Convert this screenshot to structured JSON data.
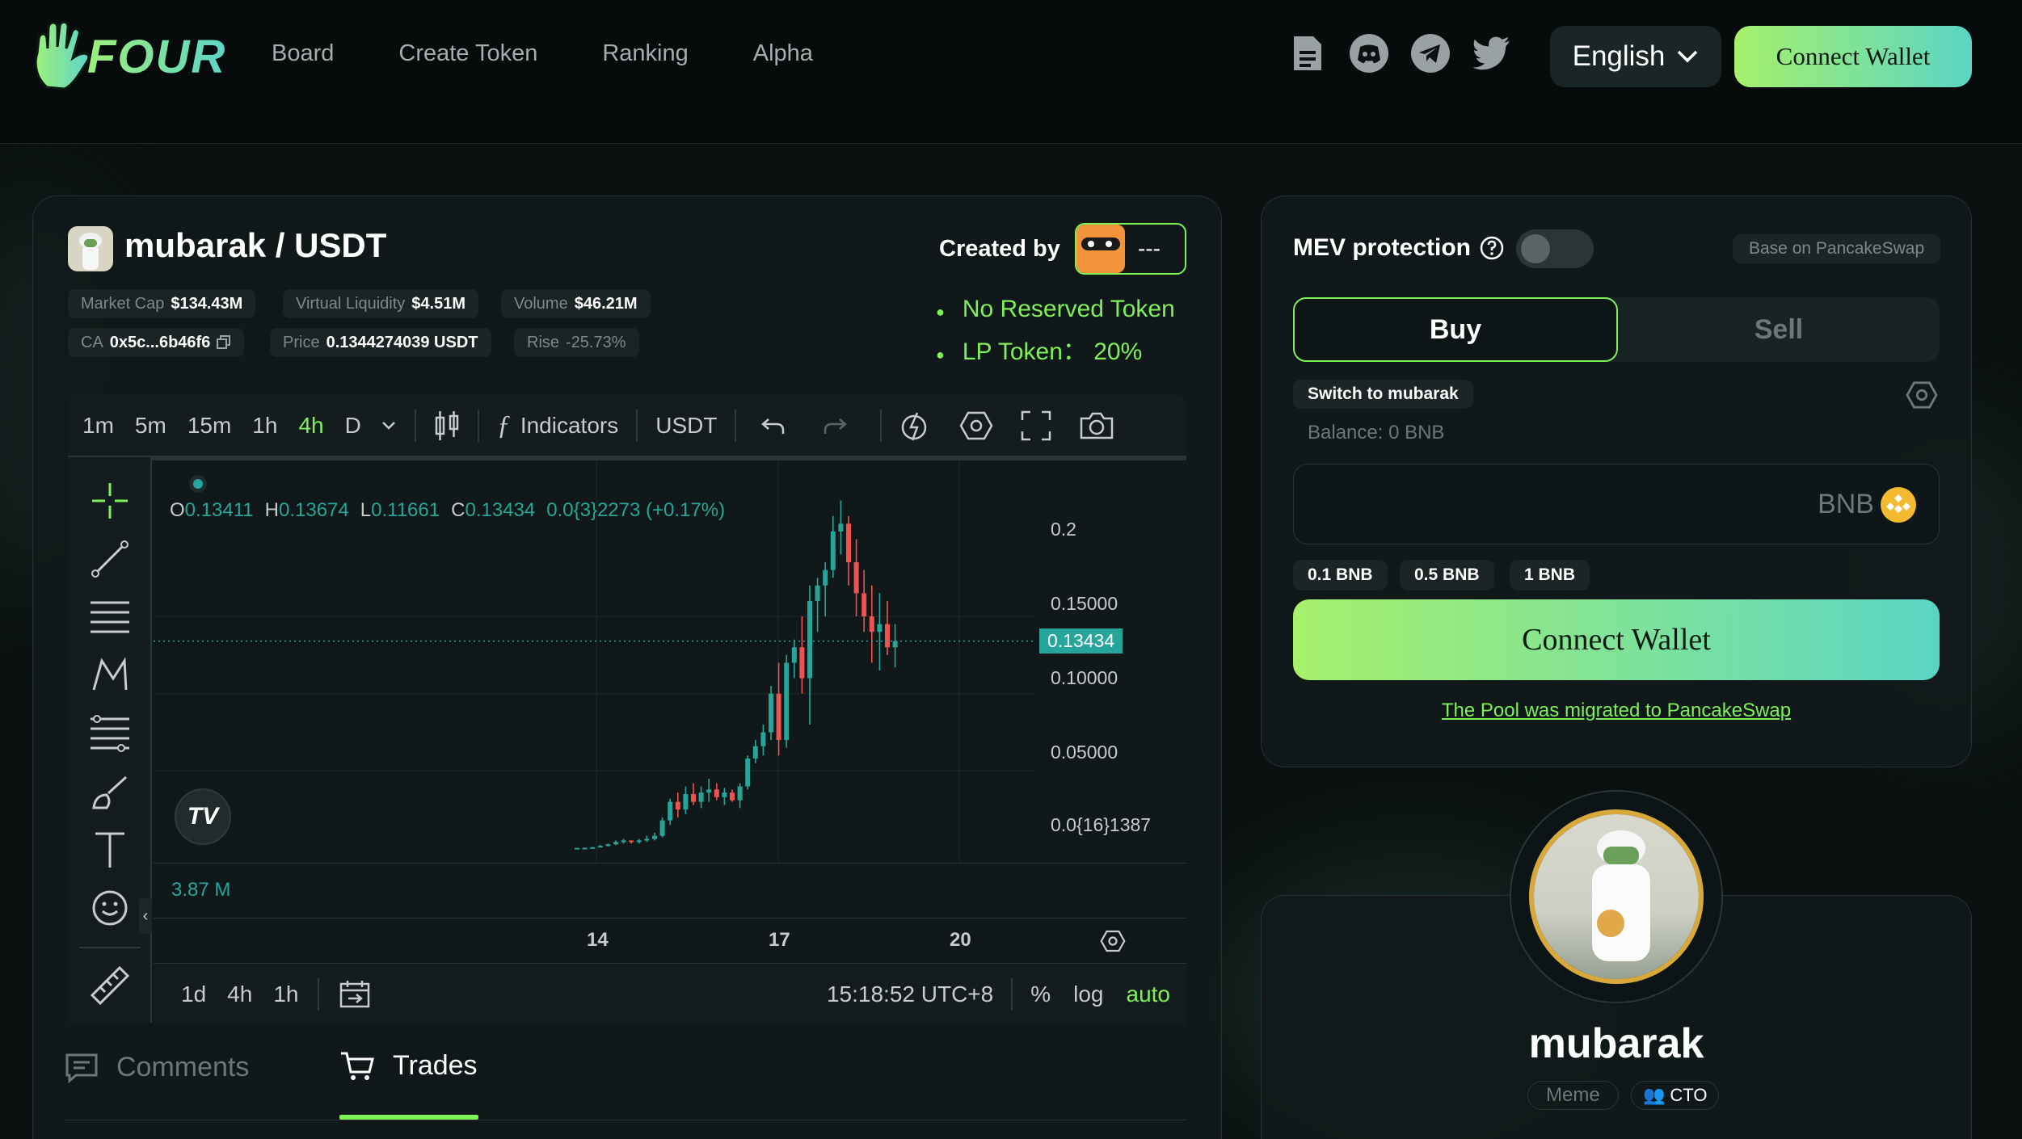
{
  "colors": {
    "accent": "#7ff05a",
    "up": "#26a69a",
    "down": "#ef5350",
    "bg": "#0b1111"
  },
  "header": {
    "logo_text": "FOUR",
    "nav": [
      "Board",
      "Create Token",
      "Ranking",
      "Alpha"
    ],
    "icons": [
      "document-icon",
      "discord-icon",
      "telegram-icon",
      "twitter-icon"
    ],
    "language": "English",
    "connect_wallet": "Connect Wallet"
  },
  "token": {
    "pair": "mubarak / USDT",
    "created_by_label": "Created by",
    "creator": "---",
    "stats": [
      {
        "label": "Market Cap",
        "value": "$134.43M"
      },
      {
        "label": "Virtual Liquidity",
        "value": "$4.51M"
      },
      {
        "label": "Volume",
        "value": "$46.21M"
      }
    ],
    "ca_label": "CA",
    "ca_value": "0x5c...6b46f6",
    "price_label": "Price",
    "price_value": "0.1344274039 USDT",
    "rise_label": "Rise",
    "rise_value": "-25.73%",
    "features": [
      "No Reserved Token",
      "LP Token： 20%"
    ]
  },
  "chart_toolbar": {
    "intervals": [
      "1m",
      "5m",
      "15m",
      "1h",
      "4h",
      "D"
    ],
    "active_interval": "4h",
    "indicators": "Indicators",
    "currency": "USDT"
  },
  "chart": {
    "ohlc": {
      "o_label": "O",
      "o": "0.13411",
      "h_label": "H",
      "h": "0.13674",
      "l_label": "L",
      "l": "0.11661",
      "c_label": "C",
      "c": "0.13434",
      "change": "0.0{3}2273 (+0.17%)"
    },
    "volume_label": "3.87 M",
    "y_ticks": [
      "0.2",
      "0.15000",
      "0.10000",
      "0.05000",
      "0.0{16}1387"
    ],
    "last_price": "0.13434",
    "x_ticks": [
      "14",
      "17",
      "20"
    ],
    "range_buttons": [
      "1d",
      "4h",
      "1h"
    ],
    "time": "15:18:52 UTC+8",
    "scale_buttons": [
      "%",
      "log",
      "auto"
    ]
  },
  "chart_data": {
    "type": "candlestick",
    "ylim": [
      0,
      0.23
    ],
    "candles": [
      [
        0.0001,
        0.0003,
        0.0001,
        0.0002
      ],
      [
        0.0002,
        0.0003,
        0.0001,
        0.0003
      ],
      [
        0.0003,
        0.0008,
        0.0002,
        0.0006
      ],
      [
        0.0006,
        0.002,
        0.0005,
        0.0015
      ],
      [
        0.0015,
        0.003,
        0.001,
        0.0025
      ],
      [
        0.0025,
        0.005,
        0.002,
        0.004
      ],
      [
        0.004,
        0.006,
        0.003,
        0.005
      ],
      [
        0.005,
        0.005,
        0.003,
        0.004
      ],
      [
        0.004,
        0.006,
        0.003,
        0.005
      ],
      [
        0.005,
        0.008,
        0.004,
        0.006
      ],
      [
        0.006,
        0.01,
        0.005,
        0.008
      ],
      [
        0.008,
        0.02,
        0.007,
        0.018
      ],
      [
        0.018,
        0.032,
        0.015,
        0.03
      ],
      [
        0.03,
        0.036,
        0.02,
        0.025
      ],
      [
        0.025,
        0.04,
        0.022,
        0.035
      ],
      [
        0.035,
        0.042,
        0.028,
        0.03
      ],
      [
        0.03,
        0.04,
        0.026,
        0.036
      ],
      [
        0.036,
        0.045,
        0.03,
        0.038
      ],
      [
        0.038,
        0.042,
        0.031,
        0.033
      ],
      [
        0.033,
        0.039,
        0.028,
        0.036
      ],
      [
        0.036,
        0.038,
        0.03,
        0.031
      ],
      [
        0.031,
        0.042,
        0.026,
        0.04
      ],
      [
        0.04,
        0.06,
        0.038,
        0.058
      ],
      [
        0.058,
        0.07,
        0.055,
        0.066
      ],
      [
        0.066,
        0.08,
        0.06,
        0.075
      ],
      [
        0.075,
        0.105,
        0.07,
        0.1
      ],
      [
        0.1,
        0.12,
        0.06,
        0.07
      ],
      [
        0.07,
        0.125,
        0.065,
        0.12
      ],
      [
        0.12,
        0.135,
        0.11,
        0.13
      ],
      [
        0.13,
        0.15,
        0.1,
        0.11
      ],
      [
        0.11,
        0.17,
        0.08,
        0.16
      ],
      [
        0.16,
        0.175,
        0.14,
        0.17
      ],
      [
        0.17,
        0.185,
        0.15,
        0.18
      ],
      [
        0.18,
        0.215,
        0.175,
        0.205
      ],
      [
        0.205,
        0.225,
        0.19,
        0.21
      ],
      [
        0.21,
        0.215,
        0.17,
        0.185
      ],
      [
        0.185,
        0.2,
        0.15,
        0.165
      ],
      [
        0.165,
        0.18,
        0.14,
        0.15
      ],
      [
        0.15,
        0.17,
        0.12,
        0.14
      ],
      [
        0.14,
        0.165,
        0.115,
        0.145
      ],
      [
        0.145,
        0.16,
        0.125,
        0.13
      ],
      [
        0.13,
        0.145,
        0.117,
        0.134
      ]
    ]
  },
  "tabs": {
    "comments": "Comments",
    "trades": "Trades"
  },
  "trade": {
    "mev_label": "MEV protection",
    "base_label": "Base on PancakeSwap",
    "buy": "Buy",
    "sell": "Sell",
    "switch": "Switch to mubarak",
    "balance": "Balance: 0 BNB",
    "currency": "BNB",
    "amounts": [
      "0.1 BNB",
      "0.5 BNB",
      "1 BNB"
    ],
    "connect_wallet": "Connect Wallet",
    "migrated": "The Pool was migrated to PancakeSwap"
  },
  "profile": {
    "name": "mubarak",
    "tags": [
      "Meme",
      "CTO"
    ]
  }
}
